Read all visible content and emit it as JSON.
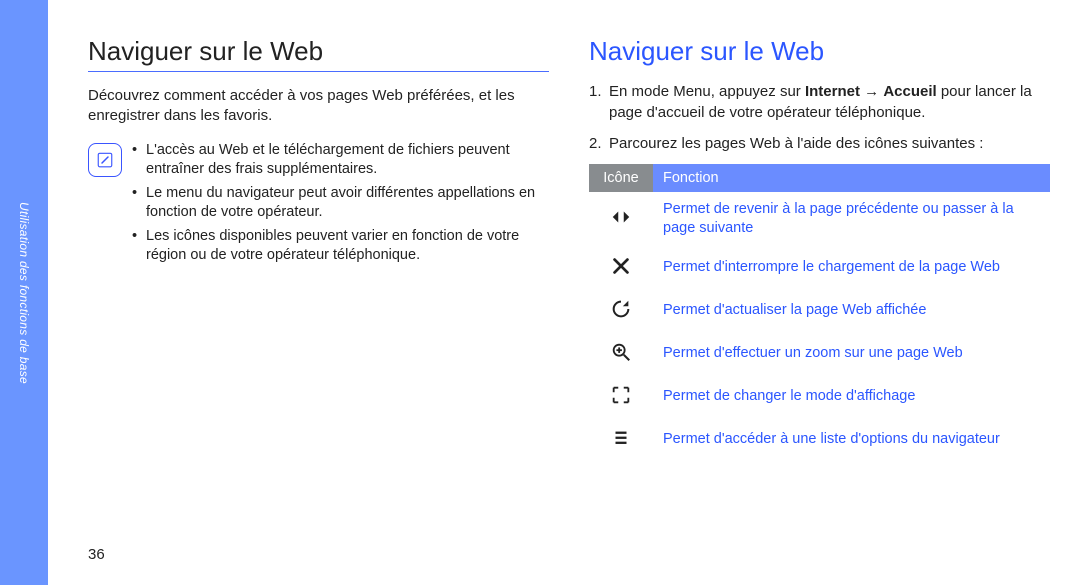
{
  "spine_label": "Utilisation des fonctions de base",
  "page_number": "36",
  "left": {
    "heading": "Naviguer sur le Web",
    "intro": "Découvrez comment accéder à vos pages Web préférées, et les enregistrer dans les favoris.",
    "notes": [
      "L'accès au Web et le téléchargement de fichiers peuvent entraîner des frais supplémentaires.",
      "Le menu du navigateur peut avoir différentes appellations en fonction de votre opérateur.",
      "Les icônes disponibles peuvent varier en fonction de votre région ou de votre opérateur téléphonique."
    ]
  },
  "right": {
    "heading": "Naviguer sur le Web",
    "steps": [
      {
        "num": "1.",
        "prefix": "En mode Menu, appuyez sur ",
        "bold1": "Internet",
        "arrow": " → ",
        "bold2": "Accueil",
        "suffix": " pour lancer la page d'accueil de votre opérateur téléphonique."
      },
      {
        "num": "2.",
        "text": "Parcourez les pages Web à l'aide des icônes suivantes :"
      }
    ],
    "table": {
      "head_icon": "Icône",
      "head_fn": "Fonction",
      "rows": [
        {
          "icon": "back-forward-icon",
          "fn": "Permet de revenir à la page précédente ou passer à la page suivante"
        },
        {
          "icon": "stop-icon",
          "fn": "Permet d'interrompre le chargement de la page Web"
        },
        {
          "icon": "refresh-icon",
          "fn": "Permet d'actualiser la page Web affichée"
        },
        {
          "icon": "zoom-icon",
          "fn": "Permet d'effectuer un zoom sur une page Web"
        },
        {
          "icon": "view-mode-icon",
          "fn": "Permet de changer le mode d'affichage"
        },
        {
          "icon": "options-icon",
          "fn": "Permet d'accéder à une liste d'options du navigateur"
        }
      ]
    }
  }
}
